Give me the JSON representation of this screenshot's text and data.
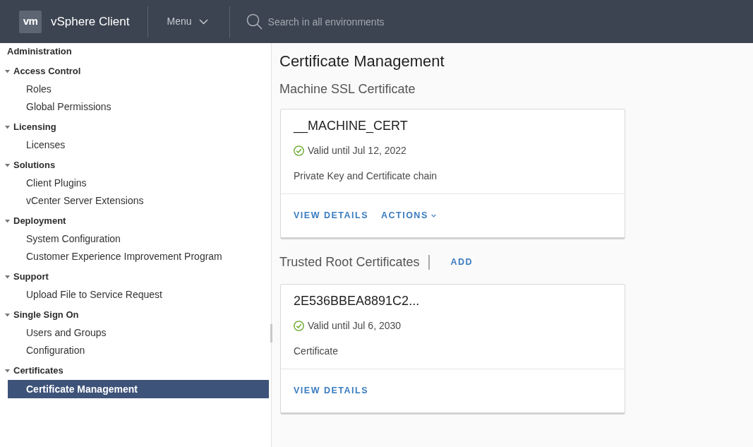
{
  "header": {
    "logo": "vm",
    "app_title": "vSphere Client",
    "menu": {
      "label": "Menu"
    },
    "search": {
      "placeholder": "Search in all environments"
    }
  },
  "sidebar": {
    "title": "Administration",
    "groups": [
      {
        "label": "Access Control",
        "expanded": true,
        "children": [
          {
            "label": "Roles",
            "selected": false
          },
          {
            "label": "Global Permissions",
            "selected": false
          }
        ]
      },
      {
        "label": "Licensing",
        "expanded": true,
        "children": [
          {
            "label": "Licenses",
            "selected": false
          }
        ]
      },
      {
        "label": "Solutions",
        "expanded": true,
        "children": [
          {
            "label": "Client Plugins",
            "selected": false
          },
          {
            "label": "vCenter Server Extensions",
            "selected": false
          }
        ]
      },
      {
        "label": "Deployment",
        "expanded": true,
        "children": [
          {
            "label": "System Configuration",
            "selected": false
          },
          {
            "label": "Customer Experience Improvement Program",
            "selected": false
          }
        ]
      },
      {
        "label": "Support",
        "expanded": true,
        "children": [
          {
            "label": "Upload File to Service Request",
            "selected": false
          }
        ]
      },
      {
        "label": "Single Sign On",
        "expanded": true,
        "children": [
          {
            "label": "Users and Groups",
            "selected": false
          },
          {
            "label": "Configuration",
            "selected": false
          }
        ]
      },
      {
        "label": "Certificates",
        "expanded": true,
        "children": [
          {
            "label": "Certificate Management",
            "selected": true
          }
        ]
      }
    ]
  },
  "main": {
    "title": "Certificate Management",
    "sections": [
      {
        "heading": "Machine SSL Certificate",
        "cards": [
          {
            "name": "__MACHINE_CERT",
            "valid": true,
            "validity": "Valid until Jul 12, 2022",
            "description": "Private Key and Certificate chain",
            "buttons": [
              {
                "label": "VIEW DETAILS",
                "kind": "link"
              },
              {
                "label": "ACTIONS",
                "kind": "dropdown"
              }
            ]
          }
        ]
      },
      {
        "heading": "Trusted Root Certificates",
        "actions": [
          "ADD"
        ],
        "cards": [
          {
            "name": "2E536BBEA8891C2...",
            "valid": true,
            "validity": "Valid until Jul 6, 2030",
            "description": "Certificate",
            "buttons": [
              {
                "label": "VIEW DETAILS",
                "kind": "link"
              }
            ]
          }
        ]
      }
    ]
  }
}
